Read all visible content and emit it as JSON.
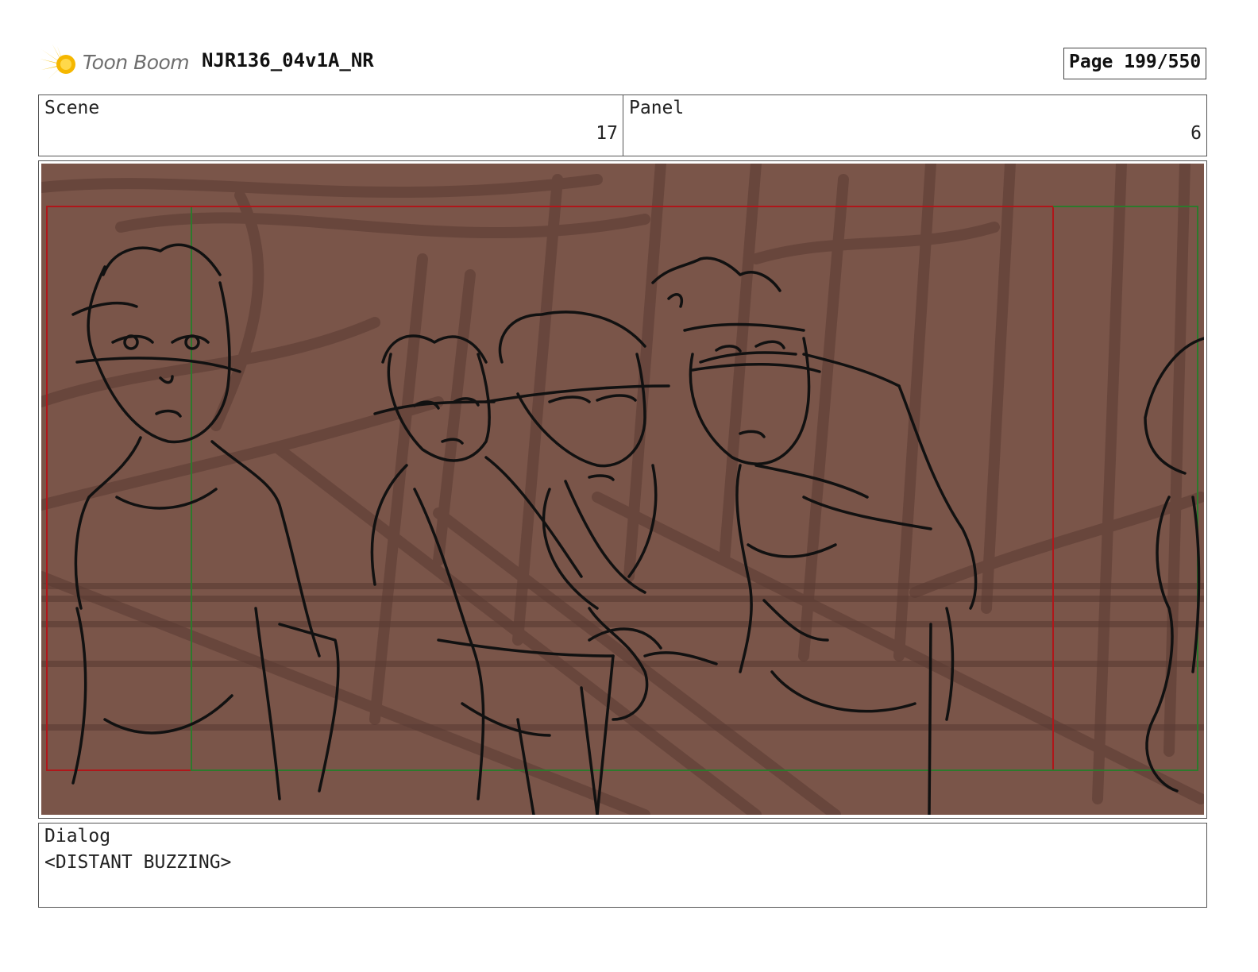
{
  "header": {
    "logo_text": "Toon Boom",
    "document_title": "NJR136_04v1A_NR",
    "page_label": "Page 199/550"
  },
  "scene": {
    "label": "Scene",
    "value": "17"
  },
  "panel": {
    "label": "Panel",
    "value": "6"
  },
  "artwork": {
    "background_color": "#7a5549",
    "safe_area_color": "#b0161a",
    "camera_frame_color": "#2c7a2c",
    "sketch_color": "#111111"
  },
  "dialog": {
    "label": "Dialog",
    "text": "<DISTANT BUZZING>"
  }
}
